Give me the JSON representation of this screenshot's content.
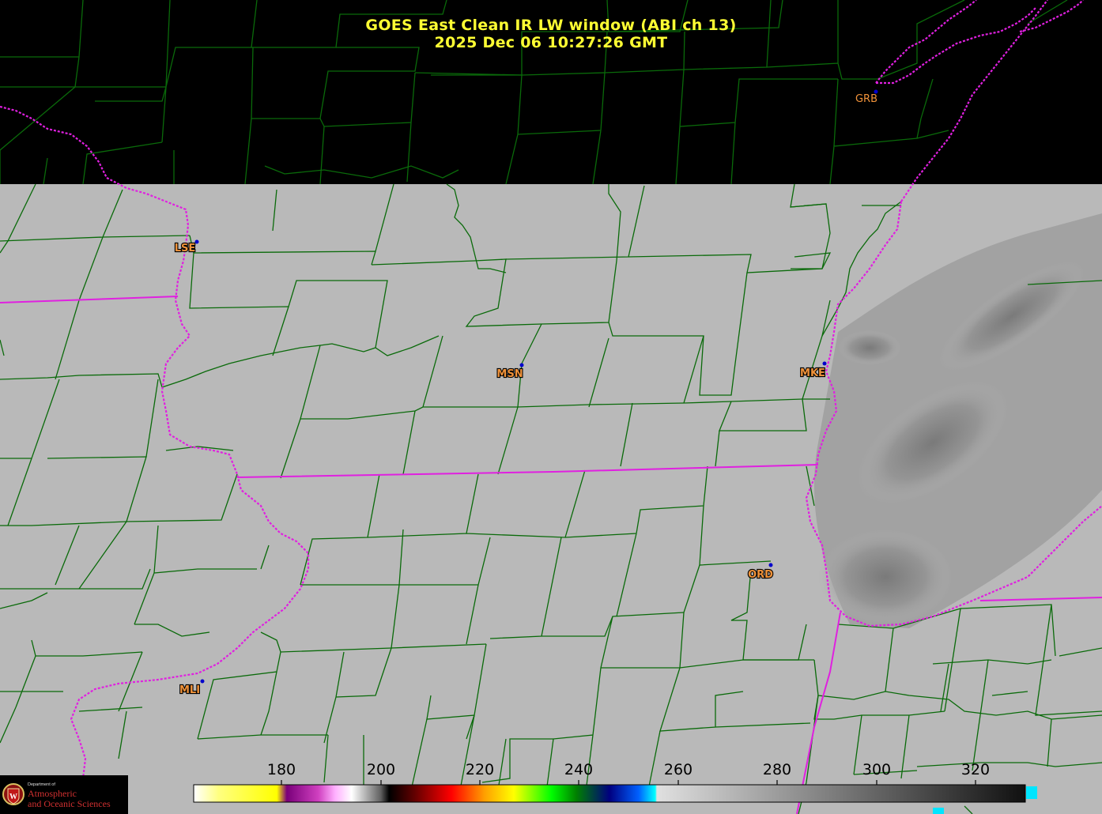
{
  "title": {
    "line1": "GOES East Clean IR LW window (ABI ch 13)",
    "line2": "2025 Dec 06  10:27:26 GMT"
  },
  "stations": [
    {
      "id": "GRB",
      "dot_color": "#0000cc",
      "style": "plain"
    },
    {
      "id": "LSE",
      "dot_color": "#0000cc",
      "style": "outlined"
    },
    {
      "id": "MSN",
      "dot_color": "#0000cc",
      "style": "outlined"
    },
    {
      "id": "MKE",
      "dot_color": "#0000cc",
      "style": "outlined"
    },
    {
      "id": "ORD",
      "dot_color": "#0000cc",
      "style": "outlined"
    },
    {
      "id": "MLI",
      "dot_color": "#0000cc",
      "style": "outlined"
    }
  ],
  "colorbar": {
    "ticks": [
      "180",
      "200",
      "220",
      "240",
      "260",
      "280",
      "300",
      "320"
    ]
  },
  "logo": {
    "dept_line": "Department of",
    "line1": "Atmospheric",
    "line2": "and Oceanic Sciences"
  },
  "colors": {
    "background": "#000000",
    "imagery_gray": "#b9b9b9",
    "county_lines": "#0a6a0a",
    "state_lines": "#e020e0",
    "title": "#ffff33",
    "station_label": "#f0923a"
  }
}
